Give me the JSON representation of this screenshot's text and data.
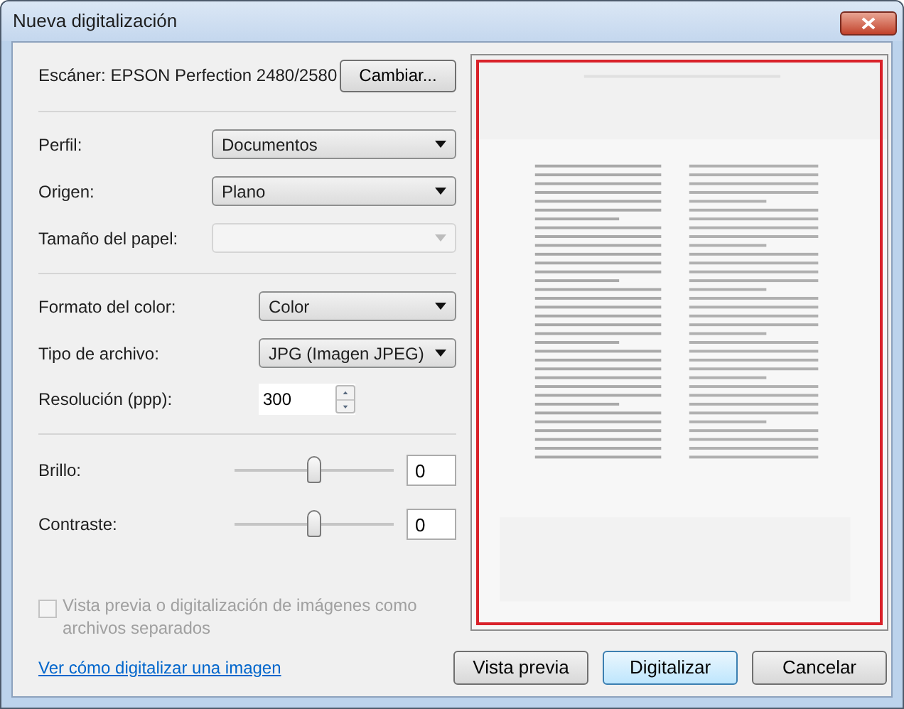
{
  "window": {
    "title": "Nueva digitalización"
  },
  "scanner": {
    "label": "Escáner: EPSON Perfection 2480/2580",
    "button": "Cambiar..."
  },
  "sections": [
    [
      {
        "kind": "select",
        "label": "Perfil:",
        "value": "Documentos",
        "disabled": false
      },
      {
        "kind": "select",
        "label": "Origen:",
        "value": "Plano",
        "disabled": false
      },
      {
        "kind": "select",
        "label": "Tamaño del papel:",
        "disabled": true
      }
    ],
    [
      {
        "kind": "select",
        "label": "Formato del color:",
        "value": "Color",
        "disabled": false
      },
      {
        "kind": "select",
        "label": "Tipo de archivo:",
        "value": "JPG (Imagen JPEG)",
        "disabled": false
      },
      {
        "kind": "spin",
        "label": "Resolución (ppp):",
        "value": "300"
      }
    ],
    [
      {
        "kind": "slider",
        "label": "Brillo:",
        "level": 0.5,
        "value": "0"
      },
      {
        "kind": "slider",
        "label": "Contraste:",
        "level": 0.5,
        "value": "0"
      }
    ]
  ],
  "separate_files": {
    "label": "Vista previa o digitalización de imágenes como archivos separados",
    "checked": false,
    "disabled": true
  },
  "help_link": "Ver cómo digitalizar una imagen",
  "buttons": [
    {
      "label": "Vista previa",
      "default": false
    },
    {
      "label": "Digitalizar",
      "default": true
    },
    {
      "label": "Cancelar",
      "default": false
    }
  ]
}
